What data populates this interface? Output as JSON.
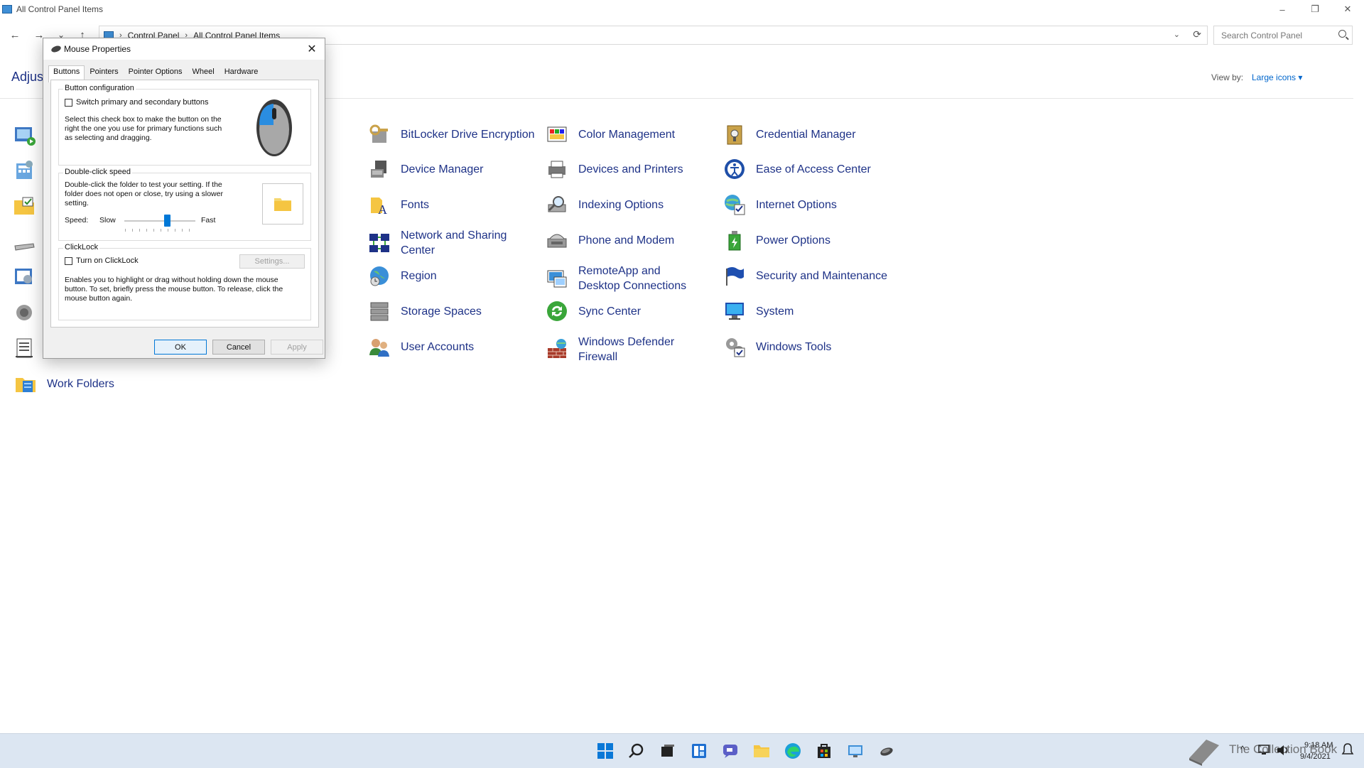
{
  "window": {
    "title": "All Control Panel Items",
    "minimize": "–",
    "maximize": "❐",
    "close": "✕"
  },
  "nav": {
    "back": "←",
    "forward": "→",
    "recent": "⌄",
    "up": "↑"
  },
  "address": {
    "crumbs": [
      "Control Panel",
      "All Control Panel Items"
    ],
    "separator": "›",
    "dropdown": "⌄",
    "refresh": "⟳"
  },
  "search": {
    "placeholder": "Search Control Panel"
  },
  "header": {
    "adjust_text": "Adjust",
    "view_by_label": "View by:",
    "view_by_value": "Large icons ▾"
  },
  "items": [
    {
      "label": "BitLocker Drive Encryption",
      "icon": "bitlocker-icon"
    },
    {
      "label": "Color Management",
      "icon": "color-management-icon"
    },
    {
      "label": "Credential Manager",
      "icon": "credential-manager-icon"
    },
    {
      "label": "Device Manager",
      "icon": "device-manager-icon"
    },
    {
      "label": "Devices and Printers",
      "icon": "devices-printers-icon"
    },
    {
      "label": "Ease of Access Center",
      "icon": "ease-of-access-icon"
    },
    {
      "label": "Fonts",
      "icon": "fonts-icon"
    },
    {
      "label": "Indexing Options",
      "icon": "indexing-icon"
    },
    {
      "label": "Internet Options",
      "icon": "internet-options-icon"
    },
    {
      "label": "Network and Sharing Center",
      "icon": "network-icon"
    },
    {
      "label": "Phone and Modem",
      "icon": "phone-modem-icon"
    },
    {
      "label": "Power Options",
      "icon": "power-options-icon"
    },
    {
      "label": "Region",
      "icon": "region-icon"
    },
    {
      "label": "RemoteApp and Desktop Connections",
      "icon": "remoteapp-icon"
    },
    {
      "label": "Security and Maintenance",
      "icon": "security-flag-icon"
    },
    {
      "label": "Storage Spaces",
      "icon": "storage-spaces-icon"
    },
    {
      "label": "Sync Center",
      "icon": "sync-center-icon"
    },
    {
      "label": "System",
      "icon": "system-icon"
    },
    {
      "label": "User Accounts",
      "icon": "user-accounts-icon"
    },
    {
      "label": "Windows Defender Firewall",
      "icon": "firewall-icon"
    },
    {
      "label": "Windows Tools",
      "icon": "windows-tools-icon"
    },
    {
      "label": "Work Folders",
      "icon": "work-folders-icon"
    }
  ],
  "dialog": {
    "title": "Mouse Properties",
    "close": "✕",
    "tabs": [
      "Buttons",
      "Pointers",
      "Pointer Options",
      "Wheel",
      "Hardware"
    ],
    "active_tab": "Buttons",
    "button_config": {
      "title": "Button configuration",
      "checkbox_label": "Switch primary and secondary buttons",
      "checked": false,
      "description": "Select this check box to make the button on the right the one you use for primary functions such as selecting and dragging."
    },
    "double_click": {
      "title": "Double-click speed",
      "description": "Double-click the folder to test your setting. If the folder does not open or close, try using a slower setting.",
      "speed_label": "Speed:",
      "slow_label": "Slow",
      "fast_label": "Fast",
      "slider_value": 0.6
    },
    "clicklock": {
      "title": "ClickLock",
      "checkbox_label": "Turn on ClickLock",
      "checked": false,
      "settings_button": "Settings...",
      "description": "Enables you to highlight or drag without holding down the mouse button. To set, briefly press the mouse button. To release, click the mouse button again."
    },
    "buttons": {
      "ok": "OK",
      "cancel": "Cancel",
      "apply": "Apply"
    }
  },
  "taskbar": {
    "watermark": "The Collection Book",
    "time": "9:18 AM",
    "date": "9/4/2021",
    "tray_icons": [
      "chevron-up-icon",
      "network-icon",
      "volume-icon"
    ]
  },
  "colors": {
    "link": "#1e3287",
    "accent": "#0078d7",
    "taskbar": "#dce6f2"
  }
}
